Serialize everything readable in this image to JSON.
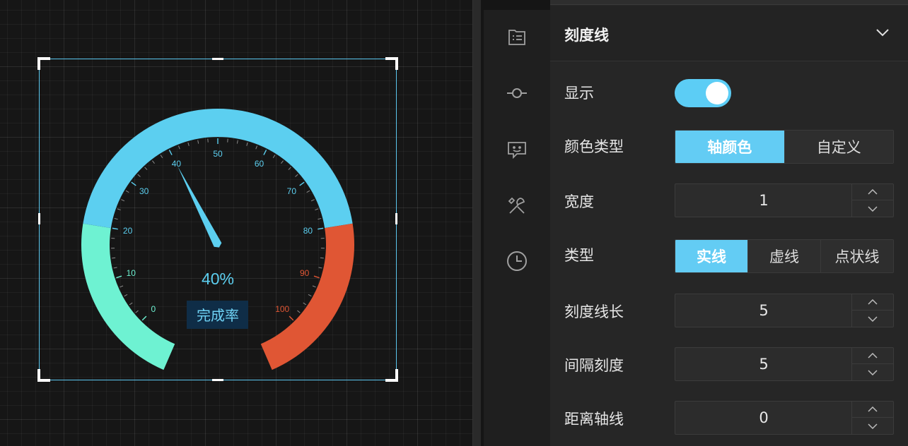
{
  "gauge": {
    "value_text": "40%",
    "label": "完成率",
    "min": 0,
    "max": 100,
    "value": 40,
    "ticks": [
      "0",
      "10",
      "20",
      "30",
      "40",
      "50",
      "60",
      "70",
      "80",
      "90",
      "100"
    ],
    "colors": {
      "low": "#6ef2d2",
      "mid": "#5ccff0",
      "high": "#e05634",
      "pointer": "#5ccff0",
      "label_bg": "#0f2d47"
    }
  },
  "sidebar_icons": [
    "list-icon",
    "node-icon",
    "chat-icon",
    "tools-icon",
    "clock-icon"
  ],
  "panel": {
    "section_title": "刻度线",
    "show_label": "显示",
    "show_on": true,
    "color_type_label": "颜色类型",
    "color_type_options": [
      "轴颜色",
      "自定义"
    ],
    "color_type_selected": "轴颜色",
    "width_label": "宽度",
    "width_value": "1",
    "type_label": "类型",
    "type_options": [
      "实线",
      "虚线",
      "点状线"
    ],
    "type_selected": "实线",
    "tick_length_label": "刻度线长",
    "tick_length_value": "5",
    "interval_label": "间隔刻度",
    "interval_value": "5",
    "axis_distance_label": "距离轴线",
    "axis_distance_value": "0"
  }
}
